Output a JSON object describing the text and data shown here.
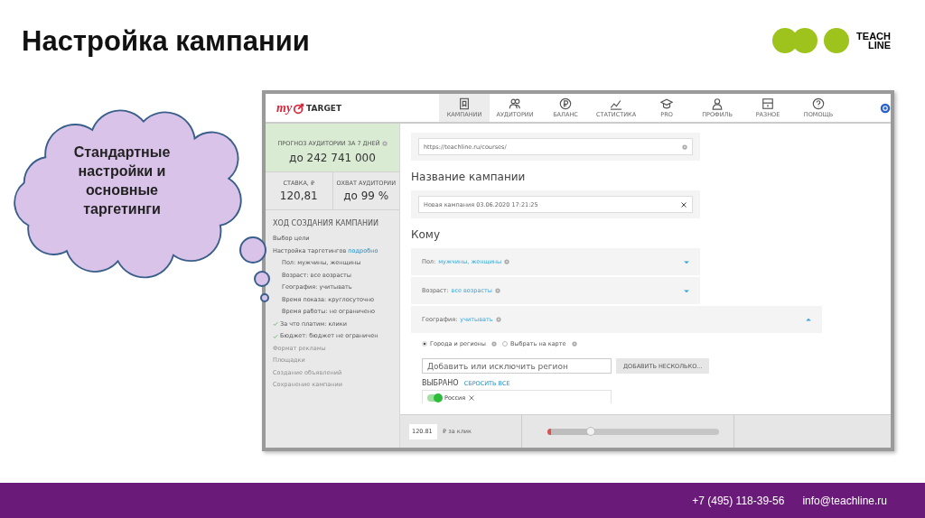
{
  "slide": {
    "title": "Настройка кампании",
    "logo_lines": [
      "TEACH",
      "LINE"
    ]
  },
  "callout": {
    "text": "Стандартные настройки и основные таргетинги"
  },
  "app": {
    "logo": {
      "prefix": "my",
      "suffix": "TARGET"
    },
    "nav": [
      {
        "label": "КАМПАНИИ",
        "selected": true
      },
      {
        "label": "АУДИТОРИИ",
        "selected": false
      },
      {
        "label": "БАЛАНС",
        "selected": false
      },
      {
        "label": "СТАТИСТИКА",
        "selected": false
      },
      {
        "label": "PRO",
        "selected": false
      },
      {
        "label": "ПРОФИЛЬ",
        "selected": false
      },
      {
        "label": "РАЗНОЕ",
        "selected": false
      },
      {
        "label": "ПОМОЩЬ",
        "selected": false
      }
    ],
    "forecast": {
      "label": "ПРОГНОЗ АУДИТОРИИ ЗА 7 ДНЕЙ",
      "value": "до 242 741 000"
    },
    "stats": [
      {
        "label": "СТАВКА, ₽",
        "value": "120,81"
      },
      {
        "label": "ОХВАТ АУДИТОРИИ",
        "value": "до 99 %"
      }
    ],
    "progress": {
      "title": "ХОД СОЗДАНИЯ КАМПАНИИ",
      "steps": [
        {
          "label": "Выбор цели",
          "checked": false,
          "disabled": false
        },
        {
          "label": "Настройка таргетингов",
          "link": "подробно",
          "checked": false,
          "disabled": false,
          "children": [
            {
              "label": "Пол: мужчины, женщины",
              "checked": false,
              "disabled": false
            },
            {
              "label": "Возраст: все возрасты",
              "checked": false,
              "disabled": false
            },
            {
              "label": "География: учитывать",
              "checked": false,
              "disabled": false
            },
            {
              "label": "Время показа: круглосуточно",
              "checked": false,
              "disabled": false
            },
            {
              "label": "Время работы: не ограничено",
              "checked": false,
              "disabled": false
            }
          ]
        },
        {
          "label": "За что платим: клики",
          "checked": true,
          "disabled": false
        },
        {
          "label": "Бюджет: бюджет не ограничен",
          "checked": true,
          "disabled": false
        },
        {
          "label": "Формат рекламы",
          "checked": false,
          "disabled": true
        },
        {
          "label": "Площадки",
          "checked": false,
          "disabled": true
        },
        {
          "label": "Создание объявлений",
          "checked": false,
          "disabled": true
        },
        {
          "label": "Сохранение кампании",
          "checked": false,
          "disabled": true
        }
      ]
    },
    "url_field": {
      "value": "https://teachline.ru/courses/"
    },
    "name_section": {
      "heading": "Название кампании",
      "value": "Новая кампания 03.06.2020 17:21:25"
    },
    "audience": {
      "heading": "Кому",
      "rows": [
        {
          "label": "Пол:",
          "value": "мужчины, женщины",
          "expanded": false
        },
        {
          "label": "Возраст:",
          "value": "все возрасты",
          "expanded": false
        },
        {
          "label": "География:",
          "value": "учитывать",
          "expanded": true,
          "panel": {
            "radios": [
              {
                "label": "Города и регионы",
                "selected": true
              },
              {
                "label": "Выбрать на карте",
                "selected": false
              }
            ],
            "region_field": {
              "placeholder": "Добавить или исключить регион"
            },
            "add_button": "ДОБАВИТЬ НЕСКОЛЬКО...",
            "selected_heading": "ВЫБРАНО",
            "reset_link": "СБРОСИТЬ ВСЕ",
            "chips": [
              {
                "label": "Россия",
                "on": true
              }
            ]
          }
        }
      ]
    },
    "bid_bar": {
      "value": "120.81",
      "unit": "₽ за клик",
      "level": 0.25
    }
  },
  "footer": {
    "phone": "+7 (495) 118-39-56",
    "email": "info@teachline.ru"
  }
}
